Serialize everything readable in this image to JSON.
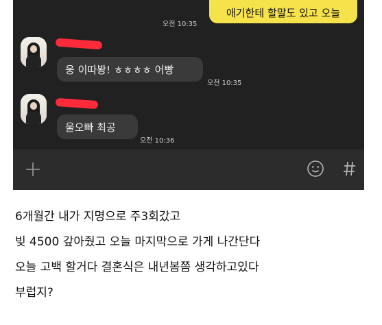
{
  "chat": {
    "outgoing": {
      "text": "애기한테 할말도 있고 오늘",
      "time": "오전 10:35"
    },
    "incoming": [
      {
        "text": "웅 이따봥! ㅎㅎㅎㅎ 어빵",
        "time": "오전 10:35"
      },
      {
        "text": "울오빠 최공",
        "time": "오전 10:36"
      }
    ],
    "input_bar": {
      "left_icon": "plus-icon",
      "right_icons": [
        "emoji-icon",
        "hash-icon"
      ]
    }
  },
  "post": {
    "lines": [
      "6개월간 내가 지명으로 주3회갔고",
      "빚 4500 갚아줬고 오늘 마지막으로 가게 나간단다",
      "오늘 고백 할거다 결혼식은 내년봄쯤 생각하고있다",
      "부럽지?"
    ]
  }
}
